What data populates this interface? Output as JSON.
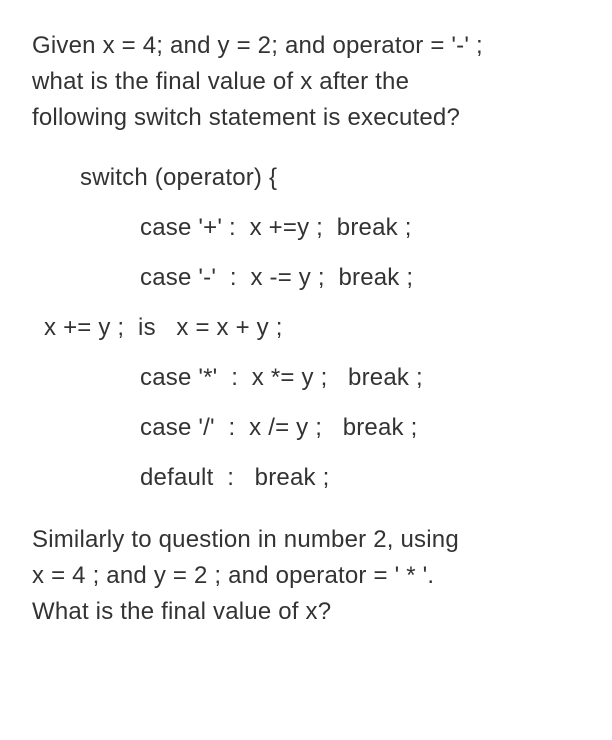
{
  "question": {
    "line1": "Given x = 4; and y = 2; and operator = '-' ;",
    "line2": "what is the final value of x after the",
    "line3": "following switch statement is executed?"
  },
  "code": {
    "switch_open": "switch (operator) {",
    "case_plus": "case '+' :  x +=y ;  break ;",
    "case_minus": "case '-'  :  x -= y ;  break ;",
    "note": "x += y ;  is   x = x + y ;",
    "case_star": "case '*'  :  x *= y ;   break ;",
    "case_slash": "case '/'  :  x /= y ;   break ;",
    "default": "default  :   break ;"
  },
  "followup": {
    "line1": "Similarly to question in number 2, using",
    "line2": "x = 4 ; and y = 2 ; and operator = ' * '.",
    "line3": "What is the final value of x?"
  }
}
